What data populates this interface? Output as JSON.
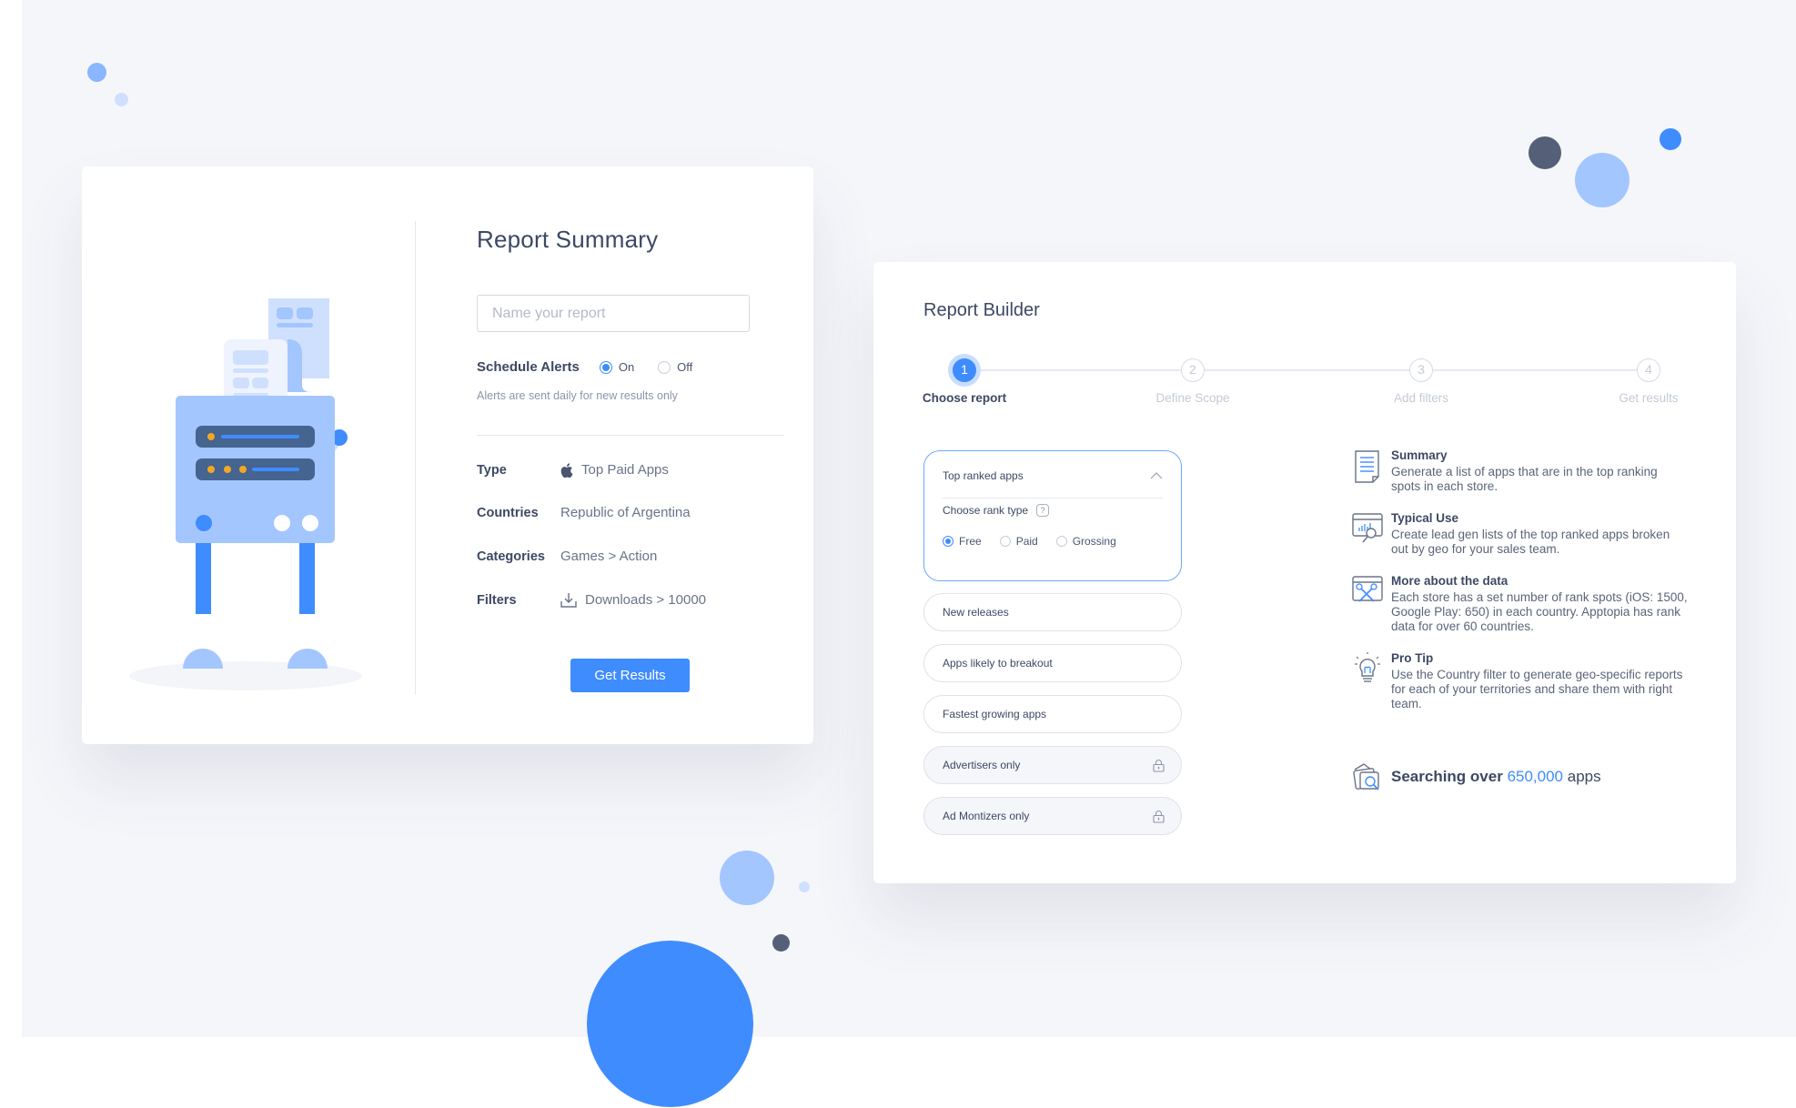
{
  "colors": {
    "accent": "#3f8cff",
    "accent_light": "#a3c6ff",
    "accent_pale": "#cfe0ff",
    "dark_slate": "#555f78",
    "background": "#f5f6fa",
    "text_primary": "#3d4863"
  },
  "summary": {
    "title": "Report Summary",
    "name_input": {
      "placeholder": "Name your report",
      "value": ""
    },
    "schedule_alerts": {
      "label": "Schedule Alerts",
      "options": [
        {
          "label": "On",
          "checked": true
        },
        {
          "label": "Off",
          "checked": false
        }
      ],
      "note": "Alerts are sent daily for new results only"
    },
    "details": [
      {
        "label": "Type",
        "icon": "apple-icon",
        "value": "Top Paid Apps"
      },
      {
        "label": "Countries",
        "icon": "",
        "value": "Republic of Argentina"
      },
      {
        "label": "Categories",
        "icon": "",
        "value": "Games > Action"
      },
      {
        "label": "Filters",
        "icon": "download-icon",
        "value": "Downloads > 10000"
      }
    ],
    "get_results_label": "Get Results"
  },
  "builder": {
    "title": "Report Builder",
    "steps": [
      {
        "number": "1",
        "label": "Choose report",
        "active": true
      },
      {
        "number": "2",
        "label": "Define Scope",
        "active": false
      },
      {
        "number": "3",
        "label": "Add filters",
        "active": false
      },
      {
        "number": "4",
        "label": "Get results",
        "active": false
      }
    ],
    "accordion": {
      "title": "Top ranked apps",
      "expanded": true,
      "rank_type_label": "Choose rank type",
      "help_glyph": "?",
      "rank_types": [
        {
          "label": "Free",
          "checked": true
        },
        {
          "label": "Paid",
          "checked": false
        },
        {
          "label": "Grossing",
          "checked": false
        }
      ]
    },
    "report_options": [
      {
        "label": "New releases",
        "locked": false
      },
      {
        "label": "Apps likely to breakout",
        "locked": false
      },
      {
        "label": "Fastest growing apps",
        "locked": false
      },
      {
        "label": "Advertisers only",
        "locked": true
      },
      {
        "label": "Ad Montizers only",
        "locked": true
      }
    ],
    "info": [
      {
        "icon": "document-icon",
        "title": "Summary",
        "text": "Generate a list of apps that are in the top ranking spots in each store."
      },
      {
        "icon": "chart-search-icon",
        "title": "Typical Use",
        "text": "Create lead gen lists of the top ranked apps broken out by geo for your sales team."
      },
      {
        "icon": "tools-icon",
        "title": "More about the data",
        "text": "Each store has a set number of rank spots (iOS: 1500, Google Play: 650) in each country. Apptopia has rank data for over 60 countries."
      },
      {
        "icon": "lightbulb-icon",
        "title": "Pro Tip",
        "text": "Use the Country filter to generate geo-specific reports for each of your territories and share them with right team."
      }
    ],
    "searching": {
      "prefix": "Searching over ",
      "count": "650,000",
      "suffix": " apps"
    }
  }
}
